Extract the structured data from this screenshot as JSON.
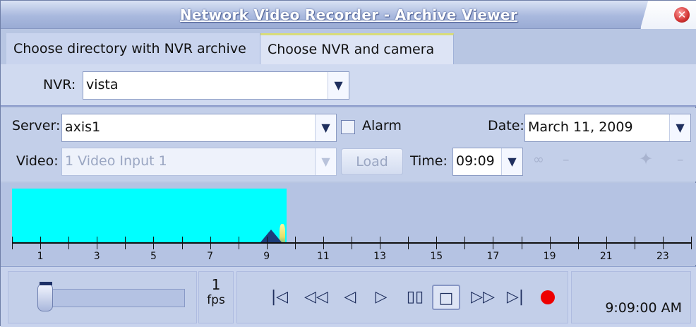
{
  "window": {
    "title": "Network Video Recorder - Archive Viewer"
  },
  "tabs": [
    {
      "label": "Choose directory with NVR archive"
    },
    {
      "label": "Choose NVR and camera"
    }
  ],
  "nvr": {
    "label": "NVR:",
    "value": "vista"
  },
  "server": {
    "label": "Server:",
    "value": "axis1",
    "alarm_label": "Alarm",
    "date_label": "Date:",
    "date_value": "March 11, 2009",
    "video_label": "Video:",
    "video_value": "1 Video Input 1",
    "load_label": "Load",
    "time_label": "Time:",
    "time_value": "09:09"
  },
  "timeline": {
    "tick_labels": [
      "1",
      "3",
      "5",
      "7",
      "9",
      "11",
      "13",
      "15",
      "17",
      "19",
      "21",
      "23"
    ],
    "recorded_until_hour": 9.7,
    "pointer_hour": 9.15,
    "fill_color": "#00ffff"
  },
  "controls": {
    "fps_value": "1",
    "fps_label": "fps",
    "buttons": [
      {
        "icon": "skip-to-start-icon",
        "glyph": "|◁"
      },
      {
        "icon": "rewind-icon",
        "glyph": "◁◁"
      },
      {
        "icon": "step-back-icon",
        "glyph": "◁"
      },
      {
        "icon": "play-icon",
        "glyph": "▷"
      },
      {
        "icon": "pause-icon",
        "glyph": "▯▯"
      },
      {
        "icon": "stop-icon",
        "glyph": "□"
      },
      {
        "icon": "fast-forward-icon",
        "glyph": "▷▷"
      },
      {
        "icon": "skip-to-end-icon",
        "glyph": "▷|"
      }
    ],
    "record_color": "#ee0000",
    "clock": "9:09:00 AM",
    "speed_level": 0.05
  }
}
